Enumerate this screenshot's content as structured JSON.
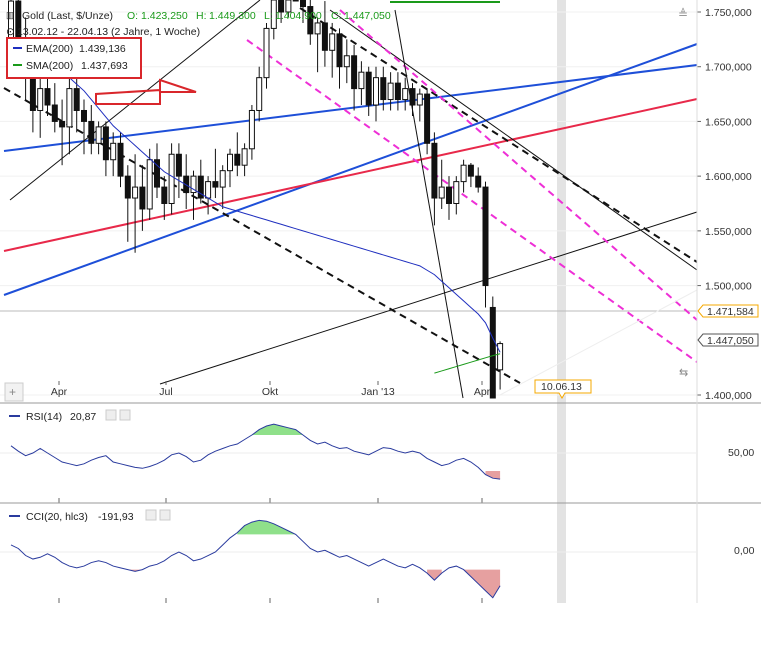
{
  "header": {
    "title": "Gold (Last, $/Unze)",
    "o_label": "O:",
    "o_value": "1.423,250",
    "h_label": "H:",
    "h_value": "1.449,300",
    "l_label": "L:",
    "l_value": "1.404,900",
    "c_label": "C:",
    "c_value": "1.447,050",
    "subtitle": "13.02.12 - 22.04.13 (2 Jahre, 1 Woche)"
  },
  "legend": {
    "ema_label": "EMA(200)",
    "ema_value": "1.439,136",
    "sma_label": "SMA(200)",
    "sma_value": "1.437,693"
  },
  "colors": {
    "ema": "#1f2fbf",
    "sma": "#1a9a1a",
    "highlight_box": "#d9262b",
    "trend_blue": "#1e4fd8",
    "trend_red": "#e8294a",
    "channel_magenta": "#ee2fd6",
    "indicator_line": "#2a3b9e",
    "overbought_fill": "#8fe08a",
    "oversold_fill": "#e6a0a0",
    "price_tag": "#f5a800"
  },
  "price_axis": {
    "ticks": [
      "1.750,000",
      "1.700,000",
      "1.650,000",
      "1.600,000",
      "1.550,000",
      "1.500,000",
      "1.400,000"
    ],
    "tag_ref": "1.471,584",
    "tag_last": "1.447,050"
  },
  "time_axis": {
    "ticks": [
      "Apr",
      "Jul",
      "Okt",
      "Jan '13",
      "Apr"
    ],
    "future_date": "10.06.13"
  },
  "rsi": {
    "label": "RSI(14)",
    "value": "20,87",
    "tick": "50,00"
  },
  "cci": {
    "label": "CCI(20, hlc3)",
    "value": "-191,93",
    "tick": "0,00"
  },
  "chart_data": {
    "type": "candlestick",
    "period": "weekly",
    "ylim": [
      1400,
      1760
    ],
    "weeks": [
      {
        "o": 1722,
        "h": 1770,
        "l": 1690,
        "c": 1760
      },
      {
        "o": 1760,
        "h": 1790,
        "l": 1700,
        "c": 1710
      },
      {
        "o": 1705,
        "h": 1745,
        "l": 1670,
        "c": 1690
      },
      {
        "o": 1690,
        "h": 1700,
        "l": 1640,
        "c": 1660
      },
      {
        "o": 1660,
        "h": 1690,
        "l": 1635,
        "c": 1680
      },
      {
        "o": 1680,
        "h": 1700,
        "l": 1655,
        "c": 1665
      },
      {
        "o": 1665,
        "h": 1685,
        "l": 1640,
        "c": 1650
      },
      {
        "o": 1650,
        "h": 1670,
        "l": 1610,
        "c": 1645
      },
      {
        "o": 1645,
        "h": 1690,
        "l": 1620,
        "c": 1680
      },
      {
        "o": 1680,
        "h": 1690,
        "l": 1640,
        "c": 1660
      },
      {
        "o": 1660,
        "h": 1670,
        "l": 1620,
        "c": 1650
      },
      {
        "o": 1650,
        "h": 1665,
        "l": 1620,
        "c": 1630
      },
      {
        "o": 1630,
        "h": 1650,
        "l": 1620,
        "c": 1645
      },
      {
        "o": 1645,
        "h": 1650,
        "l": 1600,
        "c": 1615
      },
      {
        "o": 1615,
        "h": 1640,
        "l": 1600,
        "c": 1630
      },
      {
        "o": 1630,
        "h": 1640,
        "l": 1590,
        "c": 1600
      },
      {
        "o": 1600,
        "h": 1610,
        "l": 1540,
        "c": 1580
      },
      {
        "o": 1580,
        "h": 1620,
        "l": 1530,
        "c": 1590
      },
      {
        "o": 1590,
        "h": 1610,
        "l": 1550,
        "c": 1570
      },
      {
        "o": 1570,
        "h": 1625,
        "l": 1560,
        "c": 1615
      },
      {
        "o": 1615,
        "h": 1630,
        "l": 1580,
        "c": 1590
      },
      {
        "o": 1590,
        "h": 1600,
        "l": 1560,
        "c": 1575
      },
      {
        "o": 1575,
        "h": 1630,
        "l": 1565,
        "c": 1620
      },
      {
        "o": 1620,
        "h": 1630,
        "l": 1580,
        "c": 1600
      },
      {
        "o": 1600,
        "h": 1620,
        "l": 1570,
        "c": 1585
      },
      {
        "o": 1585,
        "h": 1605,
        "l": 1560,
        "c": 1600
      },
      {
        "o": 1600,
        "h": 1615,
        "l": 1575,
        "c": 1580
      },
      {
        "o": 1580,
        "h": 1600,
        "l": 1565,
        "c": 1595
      },
      {
        "o": 1595,
        "h": 1625,
        "l": 1580,
        "c": 1590
      },
      {
        "o": 1590,
        "h": 1610,
        "l": 1570,
        "c": 1605
      },
      {
        "o": 1605,
        "h": 1625,
        "l": 1590,
        "c": 1620
      },
      {
        "o": 1620,
        "h": 1640,
        "l": 1600,
        "c": 1610
      },
      {
        "o": 1610,
        "h": 1630,
        "l": 1600,
        "c": 1625
      },
      {
        "o": 1625,
        "h": 1665,
        "l": 1615,
        "c": 1660
      },
      {
        "o": 1660,
        "h": 1700,
        "l": 1650,
        "c": 1690
      },
      {
        "o": 1690,
        "h": 1740,
        "l": 1680,
        "c": 1735
      },
      {
        "o": 1735,
        "h": 1780,
        "l": 1725,
        "c": 1770
      },
      {
        "o": 1770,
        "h": 1795,
        "l": 1740,
        "c": 1750
      },
      {
        "o": 1750,
        "h": 1800,
        "l": 1745,
        "c": 1785
      },
      {
        "o": 1785,
        "h": 1795,
        "l": 1760,
        "c": 1770
      },
      {
        "o": 1770,
        "h": 1790,
        "l": 1740,
        "c": 1755
      },
      {
        "o": 1755,
        "h": 1765,
        "l": 1720,
        "c": 1730
      },
      {
        "o": 1730,
        "h": 1745,
        "l": 1695,
        "c": 1740
      },
      {
        "o": 1740,
        "h": 1760,
        "l": 1700,
        "c": 1715
      },
      {
        "o": 1715,
        "h": 1740,
        "l": 1690,
        "c": 1730
      },
      {
        "o": 1730,
        "h": 1735,
        "l": 1680,
        "c": 1700
      },
      {
        "o": 1700,
        "h": 1725,
        "l": 1685,
        "c": 1710
      },
      {
        "o": 1710,
        "h": 1720,
        "l": 1660,
        "c": 1680
      },
      {
        "o": 1680,
        "h": 1705,
        "l": 1665,
        "c": 1695
      },
      {
        "o": 1695,
        "h": 1700,
        "l": 1655,
        "c": 1665
      },
      {
        "o": 1665,
        "h": 1700,
        "l": 1650,
        "c": 1690
      },
      {
        "o": 1690,
        "h": 1700,
        "l": 1660,
        "c": 1670
      },
      {
        "o": 1670,
        "h": 1695,
        "l": 1660,
        "c": 1685
      },
      {
        "o": 1685,
        "h": 1695,
        "l": 1660,
        "c": 1670
      },
      {
        "o": 1670,
        "h": 1690,
        "l": 1660,
        "c": 1680
      },
      {
        "o": 1680,
        "h": 1685,
        "l": 1655,
        "c": 1665
      },
      {
        "o": 1665,
        "h": 1680,
        "l": 1650,
        "c": 1675
      },
      {
        "o": 1675,
        "h": 1680,
        "l": 1620,
        "c": 1630
      },
      {
        "o": 1630,
        "h": 1640,
        "l": 1555,
        "c": 1580
      },
      {
        "o": 1580,
        "h": 1615,
        "l": 1570,
        "c": 1590
      },
      {
        "o": 1590,
        "h": 1600,
        "l": 1560,
        "c": 1575
      },
      {
        "o": 1575,
        "h": 1600,
        "l": 1565,
        "c": 1595
      },
      {
        "o": 1595,
        "h": 1615,
        "l": 1585,
        "c": 1610
      },
      {
        "o": 1610,
        "h": 1612,
        "l": 1590,
        "c": 1600
      },
      {
        "o": 1600,
        "h": 1608,
        "l": 1585,
        "c": 1590
      },
      {
        "o": 1590,
        "h": 1595,
        "l": 1480,
        "c": 1500
      },
      {
        "o": 1480,
        "h": 1490,
        "l": 1320,
        "c": 1370
      },
      {
        "o": 1423,
        "h": 1449,
        "l": 1405,
        "c": 1447
      }
    ],
    "rsi_values": [
      58,
      52,
      47,
      50,
      55,
      50,
      45,
      40,
      38,
      36,
      38,
      42,
      45,
      47,
      40,
      38,
      36,
      34,
      33,
      35,
      38,
      42,
      48,
      50,
      46,
      40,
      42,
      48,
      52,
      55,
      58,
      60,
      65,
      70,
      76,
      80,
      82,
      80,
      78,
      76,
      70,
      64,
      60,
      62,
      58,
      55,
      56,
      52,
      50,
      48,
      52,
      56,
      55,
      52,
      50,
      52,
      50,
      44,
      40,
      36,
      38,
      42,
      44,
      40,
      34,
      26,
      22,
      21
    ],
    "cci_values": [
      40,
      20,
      -20,
      -40,
      -30,
      -10,
      -30,
      -60,
      -80,
      -90,
      -80,
      -60,
      -50,
      -60,
      -80,
      -90,
      -100,
      -110,
      -100,
      -80,
      -70,
      -50,
      -20,
      0,
      -20,
      -50,
      -40,
      -20,
      0,
      40,
      80,
      110,
      150,
      170,
      180,
      175,
      160,
      140,
      120,
      100,
      60,
      20,
      0,
      10,
      -10,
      -30,
      -20,
      -40,
      -60,
      -80,
      -60,
      -40,
      -60,
      -80,
      -90,
      -70,
      -90,
      -120,
      -160,
      -120,
      -90,
      -80,
      -100,
      -140,
      -180,
      -220,
      -260,
      -192
    ],
    "ema200": [
      1720,
      1718,
      1716,
      1712,
      1708,
      1704,
      1700,
      1696,
      1690,
      1684,
      1678,
      1670,
      1662,
      1654,
      1646,
      1640,
      1634,
      1628,
      1622,
      1616,
      1610,
      1604,
      1600,
      1596,
      1592,
      1588,
      1584,
      1580,
      1576,
      1572,
      1570,
      1568,
      1566,
      1564,
      1562,
      1560,
      1558,
      1556,
      1554,
      1552,
      1550,
      1548,
      1546,
      1544,
      1542,
      1540,
      1538,
      1536,
      1534,
      1532,
      1530,
      1528,
      1526,
      1524,
      1522,
      1520,
      1518,
      1514,
      1510,
      1504,
      1498,
      1492,
      1486,
      1480,
      1474,
      1466,
      1452,
      1439
    ],
    "sma200": [
      null,
      null,
      null,
      null,
      null,
      null,
      null,
      null,
      null,
      null,
      null,
      null,
      null,
      null,
      null,
      null,
      null,
      null,
      null,
      null,
      null,
      null,
      null,
      null,
      null,
      null,
      null,
      null,
      null,
      null,
      null,
      null,
      null,
      null,
      null,
      null,
      null,
      null,
      null,
      null,
      null,
      null,
      null,
      null,
      null,
      null,
      null,
      null,
      null,
      null,
      null,
      null,
      null,
      null,
      null,
      null,
      null,
      null,
      1420,
      1422,
      1424,
      1426,
      1428,
      1430,
      1432,
      1434,
      1436,
      1437.7
    ]
  }
}
